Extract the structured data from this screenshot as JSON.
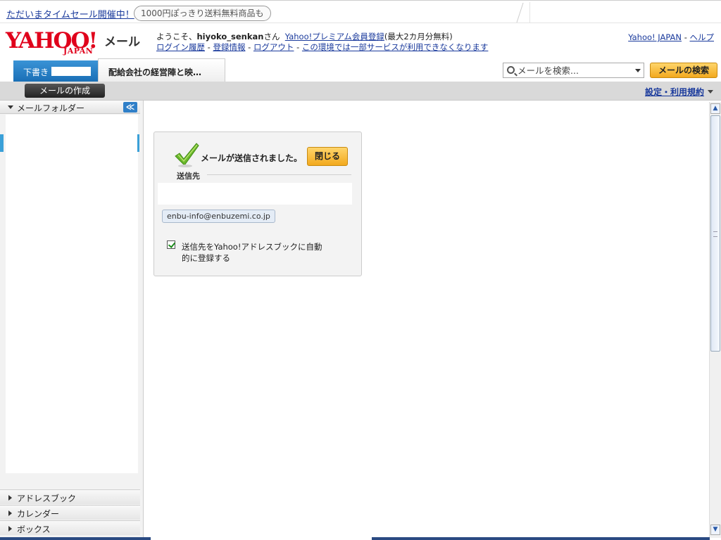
{
  "promo": {
    "link_text": "ただいまタイムセール開催中！",
    "pill_text": "1000円ぽっきり送料無料商品も"
  },
  "header": {
    "logo_yahoo": "YAHOO!",
    "logo_japan": "JAPAN",
    "app_name": "メール",
    "welcome_prefix": "ようこそ、",
    "username": "hiyoko_senkan",
    "welcome_suffix": "さん",
    "premium_link": "Yahoo!プレミアム会員登録",
    "premium_note": "(最大2カ月分無料)",
    "login_history": "ログイン履歴",
    "registration_info": "登録情報",
    "logout": "ログアウト",
    "environment_notice": "この環境では一部サービスが利用できなくなります",
    "sep": "-",
    "yahoo_japan_link": "Yahoo! JAPAN",
    "help_link": "ヘルプ"
  },
  "tabs": {
    "compose_label": "下書き",
    "draft_tab_label": "配給会社の経営陣と映…"
  },
  "search": {
    "placeholder": "メールを検索...",
    "button_label": "メールの検索"
  },
  "toolbar": {
    "compose_button": "メールの作成",
    "settings_link": "設定・利用規約"
  },
  "sidebar": {
    "folder_header": "メールフォルダー",
    "collapse_glyph": "≪",
    "sections": [
      "アドレスブック",
      "カレンダー",
      "ボックス"
    ]
  },
  "sent_panel": {
    "message": "メールが送信されました。",
    "close_button": "閉じる",
    "recipients_label": "送信先",
    "recipient": "enbu-info@enbuzemi.co.jp",
    "autosave_label": "送信先をYahoo!アドレスブックに自動的に登録する",
    "autosave_checked": true
  },
  "scrollbar": {
    "up_glyph": "▲",
    "down_glyph": "▼"
  },
  "colors": {
    "brand_red": "#e0001b",
    "link_blue": "#1a3a9c",
    "accent_blue": "#2f7fc8",
    "button_orange": "#f2a91e"
  }
}
